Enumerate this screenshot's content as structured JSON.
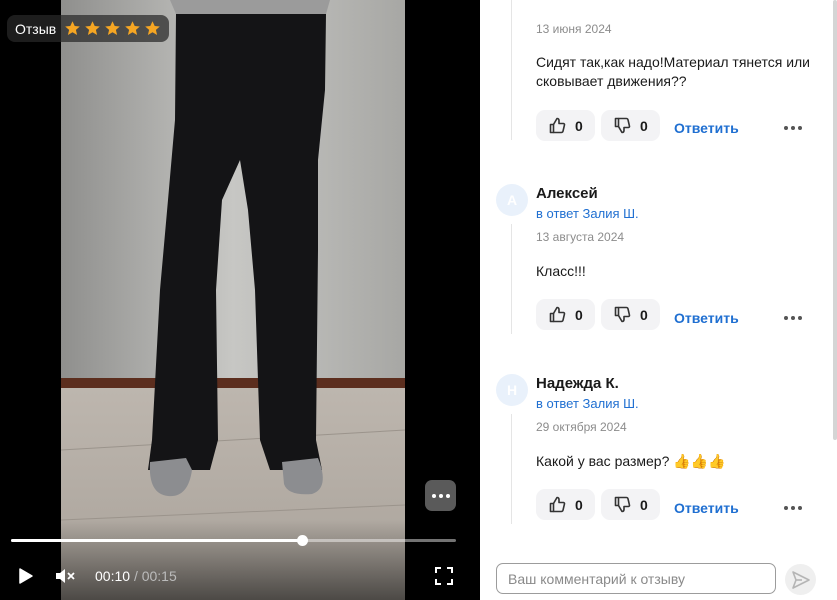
{
  "review_badge": {
    "label": "Отзыв",
    "rating": 5,
    "max_rating": 5,
    "star_color": "#f6a623"
  },
  "player": {
    "current_time": "00:10",
    "separator": "/",
    "total_time": "00:15",
    "progress": 0.655,
    "icons": {
      "play": "play-icon",
      "mute": "volume-muted-icon",
      "fullscreen": "fullscreen-icon",
      "more": "more-horizontal-icon"
    }
  },
  "comments": [
    {
      "date": "13 июня 2024",
      "text": "Сидят так,как надо!Материал тянется или сковывает движения??",
      "likes": "0",
      "dislikes": "0",
      "reply_label": "Ответить"
    },
    {
      "avatar": "А",
      "author": "Алексей",
      "reply_to": "в ответ Залия Ш.",
      "date": "13 августа 2024",
      "text": "Класс!!!",
      "likes": "0",
      "dislikes": "0",
      "reply_label": "Ответить"
    },
    {
      "avatar": "Н",
      "author": "Надежда К.",
      "reply_to": "в ответ Залия Ш.",
      "date": "29 октября 2024",
      "text": "Какой у вас размер? 👍👍👍",
      "likes": "0",
      "dislikes": "0",
      "reply_label": "Ответить"
    }
  ],
  "comment_input": {
    "placeholder": "Ваш комментарий к отзыву",
    "value": ""
  },
  "colors": {
    "accent": "#1f6fd1",
    "vote_bg": "#f3f3f5"
  }
}
